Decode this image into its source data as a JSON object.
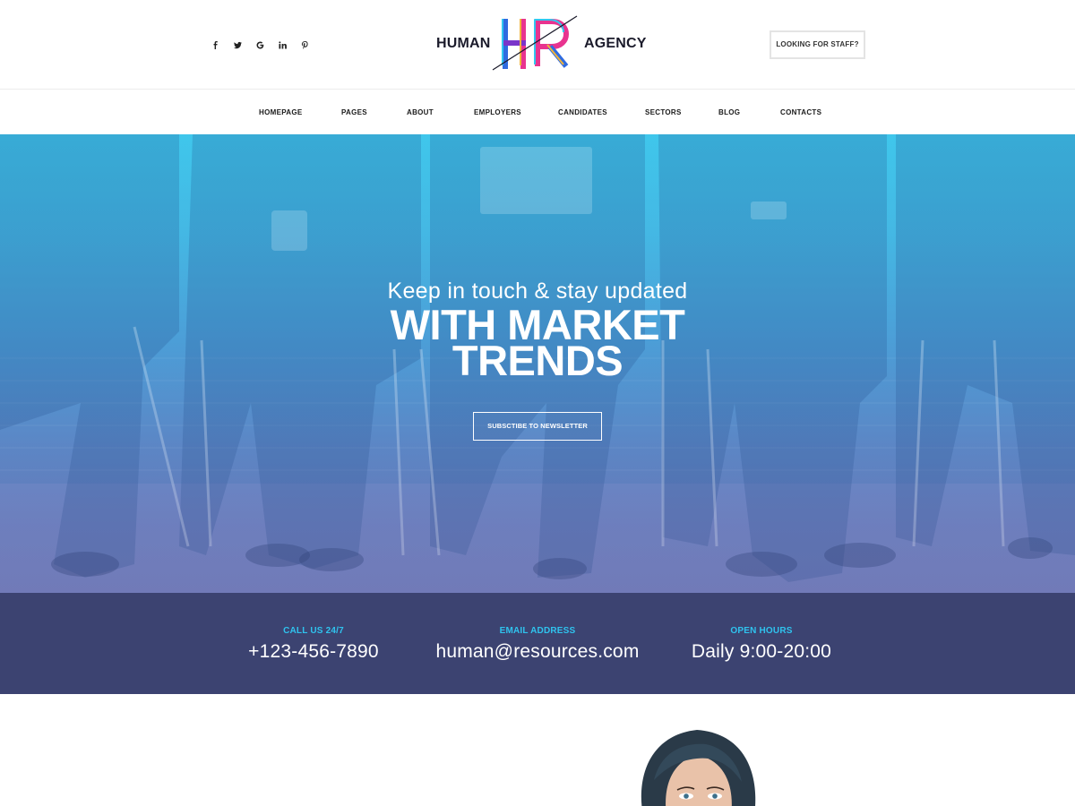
{
  "header": {
    "social": [
      {
        "name": "facebook",
        "glyph": "f"
      },
      {
        "name": "twitter",
        "glyph": "t"
      },
      {
        "name": "google",
        "glyph": "G"
      },
      {
        "name": "linkedin",
        "glyph": "in"
      },
      {
        "name": "pinterest",
        "glyph": "p"
      }
    ],
    "logo": {
      "left": "HUMAN",
      "mark": "HR",
      "right": "AGENCY"
    },
    "cta": "LOOKING FOR STAFF?"
  },
  "nav": {
    "items": [
      "HOMEPAGE",
      "PAGES",
      "ABOUT",
      "EMPLOYERS",
      "CANDIDATES",
      "SECTORS",
      "BLOG",
      "CONTACTS"
    ]
  },
  "hero": {
    "subtitle": "Keep in touch & stay updated",
    "title_line1": "WITH MARKET",
    "title_line2": "TRENDS",
    "button": "SUBSCTIBE TO NEWSLETTER"
  },
  "contact": {
    "phone_label": "CALL US 24/7",
    "phone": "+123-456-7890",
    "email_label": "EMAIL ADDRESS",
    "email": "human@resources.com",
    "hours_label": "OPEN HOURS",
    "hours": "Daily 9:00-20:00"
  },
  "colors": {
    "accent_cyan": "#2fc3ee",
    "band_navy": "#3c4371",
    "logo_pink": "#e8338f",
    "logo_blue": "#2f6be0"
  }
}
